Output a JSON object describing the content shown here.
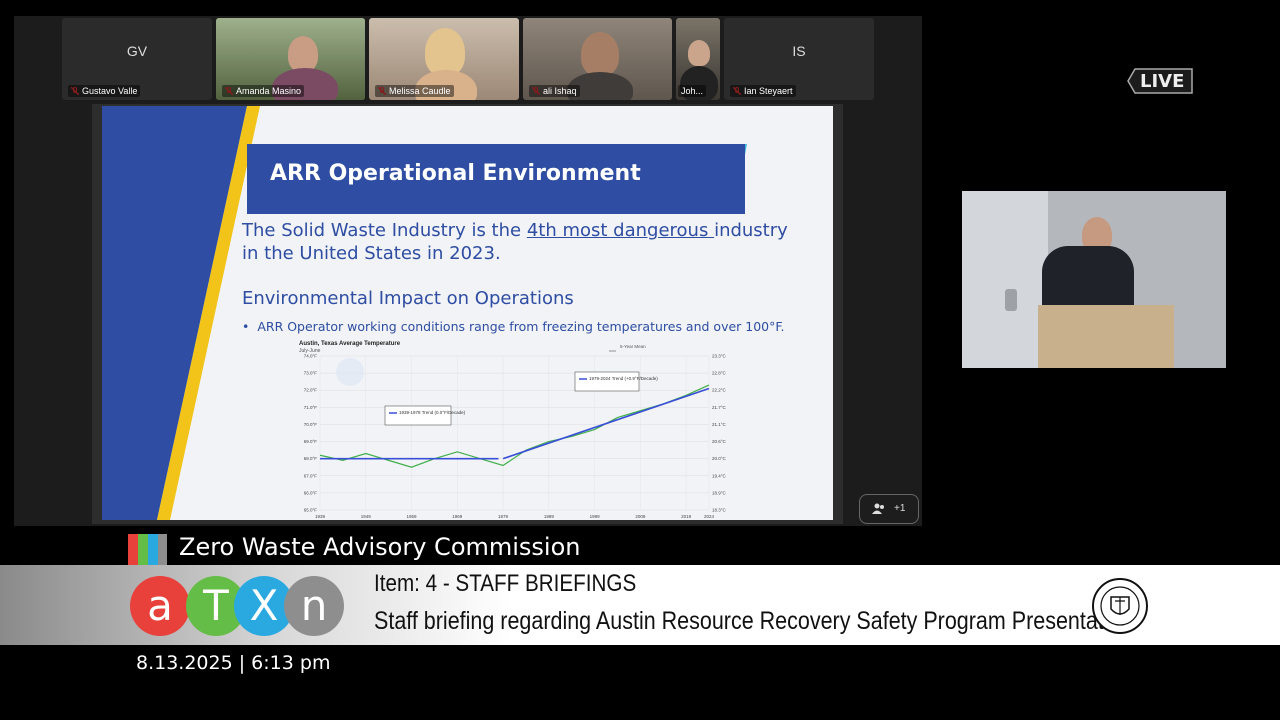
{
  "meeting": {
    "live_label": "LIVE",
    "people_count": "+1"
  },
  "participants": [
    {
      "name": "Gustavo Valle",
      "initials": "GV",
      "video": false
    },
    {
      "name": "Amanda Masino",
      "video": true
    },
    {
      "name": "Melissa Caudle",
      "video": true
    },
    {
      "name": "ali Ishaq",
      "video": true
    },
    {
      "name": "Joh...",
      "video": true
    },
    {
      "name": "Ian Steyaert",
      "initials": "IS",
      "video": false
    }
  ],
  "slide": {
    "title": "ARR Operational Environment",
    "line1_pre": "The Solid Waste Industry is the ",
    "line1_link": "4th most dangerous ",
    "line1_post": "industry",
    "line2": "in the United States in 2023.",
    "subheading": "Environmental Impact on Operations",
    "bullet": "ARR Operator working conditions range from freezing temperatures and over 100°F.",
    "chart_title": "Austin, Texas Average Temperature",
    "chart_subtitle": "July-June",
    "legend_mean": "5-Year Mean",
    "legend_trend_1": "1939-1978 Trend (0.0°F/Decade)",
    "legend_trend_2": "1979-2024 Trend (+0.9°F/Decade)"
  },
  "chart_data": {
    "type": "line",
    "title": "Austin, Texas Average Temperature",
    "subtitle": "July-June",
    "x_ticks": [
      "1939",
      "1949",
      "1959",
      "1969",
      "1979",
      "1989",
      "1999",
      "2009",
      "2019",
      "2024"
    ],
    "y_ticks_left": [
      "65.0°F",
      "66.0°F",
      "67.0°F",
      "68.0°F",
      "69.0°F",
      "70.0°F",
      "71.0°F",
      "72.0°F",
      "73.0°F",
      "74.0°F"
    ],
    "y_ticks_right": [
      "18.3°C",
      "18.9°C",
      "19.4°C",
      "20.0°C",
      "20.6°C",
      "21.1°C",
      "21.7°C",
      "22.2°C",
      "22.8°C",
      "23.3°C"
    ],
    "ylim": [
      65,
      74
    ],
    "series": [
      {
        "name": "5-Year Mean",
        "x": [
          1939,
          1944,
          1949,
          1954,
          1959,
          1964,
          1969,
          1974,
          1979,
          1984,
          1989,
          1994,
          1999,
          2004,
          2009,
          2014,
          2019,
          2024
        ],
        "values": [
          68.2,
          67.9,
          68.3,
          67.9,
          67.5,
          68.0,
          68.4,
          68.0,
          67.6,
          68.5,
          69.0,
          69.3,
          69.7,
          70.4,
          70.8,
          71.2,
          71.7,
          72.3
        ]
      }
    ],
    "trends": [
      {
        "name": "1939-1978 Trend (0.0°F/Decade)",
        "x": [
          1939,
          1978
        ],
        "values": [
          68.0,
          68.0
        ]
      },
      {
        "name": "1979-2024 Trend (+0.9°F/Decade)",
        "x": [
          1979,
          2024
        ],
        "values": [
          68.0,
          72.1
        ]
      }
    ]
  },
  "broadcast": {
    "commission": "Zero Waste Advisory Commission",
    "item": "Item: 4 - STAFF BRIEFINGS",
    "briefing": "Staff briefing regarding Austin Resource Recovery Safety Program Presentation",
    "datetime": "8.13.2025 | 6:13 pm",
    "logo_letters": [
      "a",
      "T",
      "X",
      "n"
    ]
  }
}
